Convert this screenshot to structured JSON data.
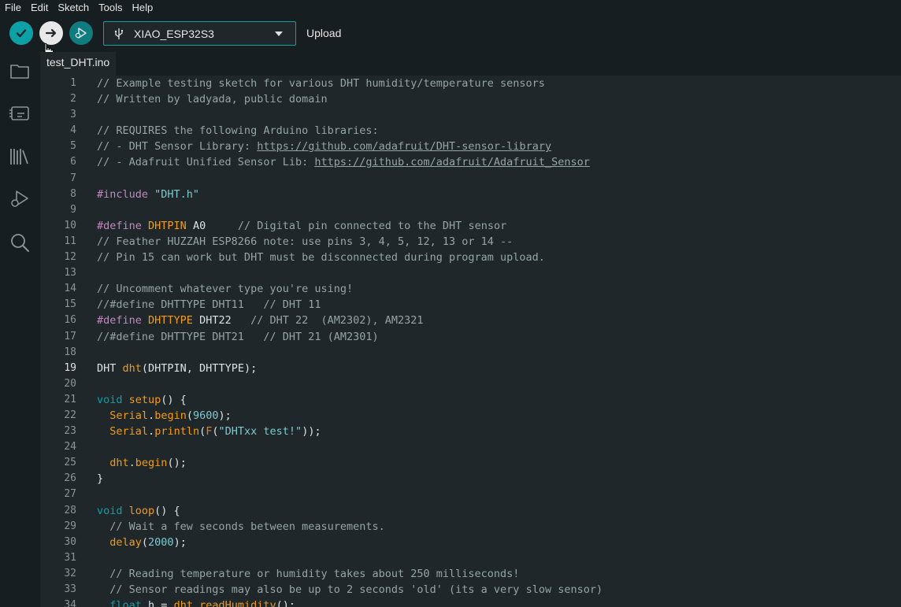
{
  "menu": {
    "file": "File",
    "edit": "Edit",
    "sketch": "Sketch",
    "tools": "Tools",
    "help": "Help"
  },
  "toolbar": {
    "board_name": "XIAO_ESP32S3",
    "hover_label": "Upload"
  },
  "tab": {
    "file_name": "test_DHT.ino"
  },
  "editor": {
    "active_line": 19,
    "line_numbers": [
      "1",
      "2",
      "3",
      "4",
      "5",
      "6",
      "7",
      "8",
      "9",
      "10",
      "11",
      "12",
      "13",
      "14",
      "15",
      "16",
      "17",
      "18",
      "19",
      "20",
      "21",
      "22",
      "23",
      "24",
      "25",
      "26",
      "27",
      "28",
      "29",
      "30",
      "31",
      "32",
      "33",
      "34"
    ],
    "lines": [
      [
        [
          "c",
          "// Example testing sketch for various DHT humidity/temperature sensors"
        ]
      ],
      [
        [
          "c",
          "// Written by ladyada, public domain"
        ]
      ],
      [],
      [
        [
          "c",
          "// REQUIRES the following Arduino libraries:"
        ]
      ],
      [
        [
          "c",
          "// - DHT Sensor Library: "
        ],
        [
          "u",
          "https://github.com/adafruit/DHT-sensor-library"
        ]
      ],
      [
        [
          "c",
          "// - Adafruit Unified Sensor Lib: "
        ],
        [
          "u",
          "https://github.com/adafruit/Adafruit_Sensor"
        ]
      ],
      [],
      [
        [
          "p",
          "#include "
        ],
        [
          "s",
          "\"DHT.h\""
        ]
      ],
      [],
      [
        [
          "p",
          "#define "
        ],
        [
          "f",
          "DHTPIN"
        ],
        [
          "t",
          " A0     "
        ],
        [
          "c",
          "// Digital pin connected to the DHT sensor"
        ]
      ],
      [
        [
          "c",
          "// Feather HUZZAH ESP8266 note: use pins 3, 4, 5, 12, 13 or 14 --"
        ]
      ],
      [
        [
          "c",
          "// Pin 15 can work but DHT must be disconnected during program upload."
        ]
      ],
      [],
      [
        [
          "c",
          "// Uncomment whatever type you're using!"
        ]
      ],
      [
        [
          "c",
          "//#define DHTTYPE DHT11   // DHT 11"
        ]
      ],
      [
        [
          "p",
          "#define "
        ],
        [
          "f",
          "DHTTYPE"
        ],
        [
          "t",
          " DHT22   "
        ],
        [
          "c",
          "// DHT 22  (AM2302), AM2321"
        ]
      ],
      [
        [
          "c",
          "//#define DHTTYPE DHT21   // DHT 21 (AM2301)"
        ]
      ],
      [],
      [
        [
          "t",
          "DHT "
        ],
        [
          "f",
          "dht"
        ],
        [
          "t",
          "(DHTPIN, DHTTYPE);"
        ]
      ],
      [],
      [
        [
          "k",
          "void "
        ],
        [
          "f",
          "setup"
        ],
        [
          "t",
          "() {"
        ]
      ],
      [
        [
          "t",
          "  "
        ],
        [
          "f",
          "Serial"
        ],
        [
          "t",
          "."
        ],
        [
          "f",
          "begin"
        ],
        [
          "t",
          "("
        ],
        [
          "n",
          "9600"
        ],
        [
          "t",
          ");"
        ]
      ],
      [
        [
          "t",
          "  "
        ],
        [
          "f",
          "Serial"
        ],
        [
          "t",
          "."
        ],
        [
          "f",
          "println"
        ],
        [
          "t",
          "("
        ],
        [
          "y",
          "F"
        ],
        [
          "t",
          "("
        ],
        [
          "s",
          "\"DHTxx test!\""
        ],
        [
          "t",
          "));"
        ]
      ],
      [],
      [
        [
          "t",
          "  "
        ],
        [
          "f",
          "dht"
        ],
        [
          "t",
          "."
        ],
        [
          "f",
          "begin"
        ],
        [
          "t",
          "();"
        ]
      ],
      [
        [
          "t",
          "}"
        ]
      ],
      [],
      [
        [
          "k",
          "void "
        ],
        [
          "f",
          "loop"
        ],
        [
          "t",
          "() {"
        ]
      ],
      [
        [
          "t",
          "  "
        ],
        [
          "c",
          "// Wait a few seconds between measurements."
        ]
      ],
      [
        [
          "t",
          "  "
        ],
        [
          "f",
          "delay"
        ],
        [
          "t",
          "("
        ],
        [
          "n",
          "2000"
        ],
        [
          "t",
          ");"
        ]
      ],
      [],
      [
        [
          "t",
          "  "
        ],
        [
          "c",
          "// Reading temperature or humidity takes about 250 milliseconds!"
        ]
      ],
      [
        [
          "t",
          "  "
        ],
        [
          "c",
          "// Sensor readings may also be up to 2 seconds 'old' (its a very slow sensor)"
        ]
      ],
      [
        [
          "t",
          "  "
        ],
        [
          "k",
          "float "
        ],
        [
          "t",
          "h = "
        ],
        [
          "f",
          "dht"
        ],
        [
          "t",
          "."
        ],
        [
          "f",
          "readHumidity"
        ],
        [
          "t",
          "();"
        ]
      ]
    ]
  },
  "colors": {
    "accent": "#0ca1a6",
    "background": "#1f272b",
    "chrome": "#171e21"
  },
  "icons": {
    "verify": "check-icon",
    "upload": "arrow-right-icon",
    "debug": "debug-icon",
    "usb": "usb-icon",
    "dropdown": "caret-down-icon",
    "sketchbook": "folder-icon",
    "boards": "board-manager-icon",
    "library": "library-icon",
    "debugger": "debugger-icon",
    "search": "search-icon"
  }
}
